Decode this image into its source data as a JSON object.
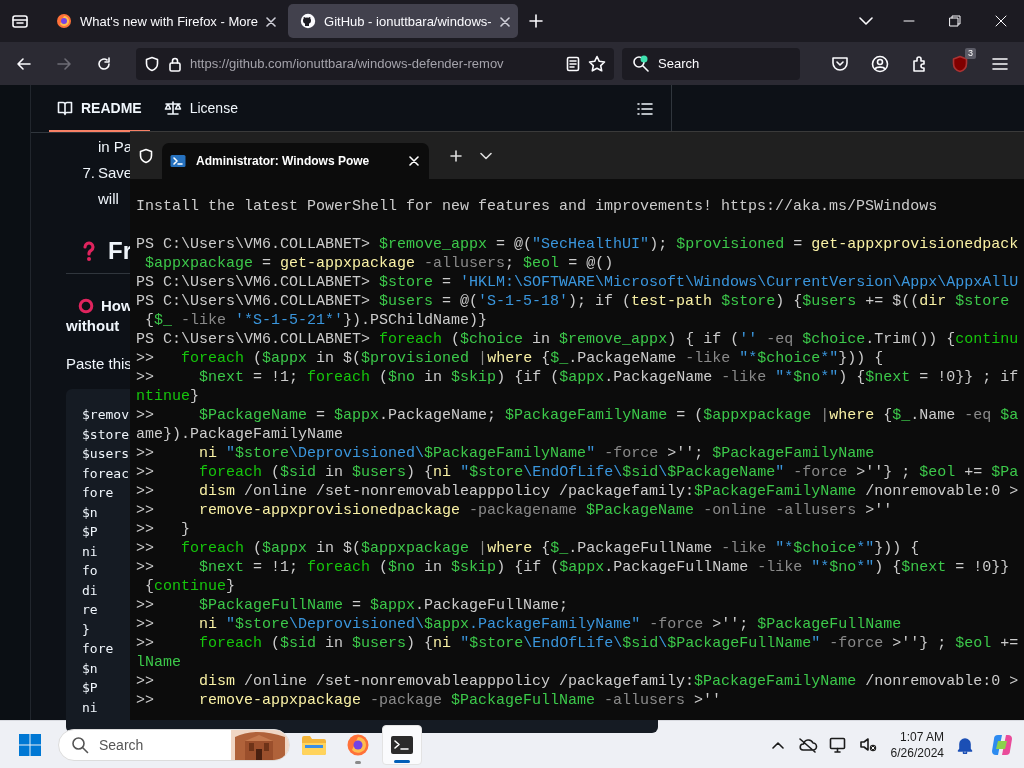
{
  "browser": {
    "tabs": [
      {
        "kind": "firefox",
        "title": "What's new with Firefox - More",
        "selected": false
      },
      {
        "kind": "github",
        "title": "GitHub - ionuttbara/windows-",
        "selected": true
      }
    ],
    "forward_disabled": true,
    "url": "https://github.com/ionuttbara/windows-defender-remov",
    "search_placeholder": "Search",
    "extension_badge": "3"
  },
  "github": {
    "nav": [
      {
        "kind": "book",
        "label": "README",
        "selected": true
      },
      {
        "kind": "scale",
        "label": "License",
        "selected": false
      }
    ],
    "content": [
      {
        "kind": "continuation",
        "text": "in Pa"
      },
      {
        "kind": "numbered",
        "number": "7.",
        "text": "Save"
      },
      {
        "kind": "continuation",
        "text": "will"
      },
      {
        "kind": "heading",
        "text": "Fr"
      },
      {
        "kind": "question",
        "text": "How"
      },
      {
        "kind": "bold",
        "text": "without"
      },
      {
        "kind": "paragraph",
        "text": "Paste this"
      }
    ],
    "code": [
      "$remov",
      "$store",
      "$users",
      "foreac",
      "  fore",
      "    $n",
      "    $P",
      "    ni",
      "    fo",
      "    di",
      "    re",
      "  }",
      "  fore",
      "    $n",
      "    $P",
      "    ni"
    ]
  },
  "terminal": {
    "tab_title": "Administrator: Windows Powe",
    "banner": "Install the latest PowerShell for new features and improvements! https://aka.ms/PSWindows",
    "lines": [
      [
        {
          "kind": "plain",
          "text": "PS C:\\Users\\VM6.COLLABNET> "
        },
        {
          "kind": "variable",
          "text": "$remove_appx"
        },
        {
          "kind": "plain",
          "text": " = @("
        },
        {
          "kind": "string",
          "text": "\"SecHealthUI\""
        },
        {
          "kind": "plain",
          "text": "); "
        },
        {
          "kind": "variable",
          "text": "$provisioned"
        },
        {
          "kind": "plain",
          "text": " = "
        },
        {
          "kind": "command",
          "text": "get-appxprovisionedpack"
        }
      ],
      [
        {
          "kind": "variable",
          "text": " $appxpackage"
        },
        {
          "kind": "plain",
          "text": " = "
        },
        {
          "kind": "command",
          "text": "get-appxpackage"
        },
        {
          "kind": "parameter",
          "text": " -allusers"
        },
        {
          "kind": "plain",
          "text": "; "
        },
        {
          "kind": "variable",
          "text": "$eol"
        },
        {
          "kind": "plain",
          "text": " = @()"
        }
      ],
      [
        {
          "kind": "plain",
          "text": "PS C:\\Users\\VM6.COLLABNET> "
        },
        {
          "kind": "variable",
          "text": "$store"
        },
        {
          "kind": "plain",
          "text": " = "
        },
        {
          "kind": "string",
          "text": "'HKLM:\\SOFTWARE\\Microsoft\\Windows\\CurrentVersion\\Appx\\AppxAllU"
        }
      ],
      [
        {
          "kind": "plain",
          "text": "PS C:\\Users\\VM6.COLLABNET> "
        },
        {
          "kind": "variable",
          "text": "$users"
        },
        {
          "kind": "plain",
          "text": " = @("
        },
        {
          "kind": "string",
          "text": "'S-1-5-18'"
        },
        {
          "kind": "plain",
          "text": "); if ("
        },
        {
          "kind": "command",
          "text": "test-path"
        },
        {
          "kind": "variable",
          "text": " $store"
        },
        {
          "kind": "plain",
          "text": ") {"
        },
        {
          "kind": "variable",
          "text": "$users"
        },
        {
          "kind": "plain",
          "text": " += $(("
        },
        {
          "kind": "command",
          "text": "dir"
        },
        {
          "kind": "variable",
          "text": " $store"
        }
      ],
      [
        {
          "kind": "plain",
          "text": " {"
        },
        {
          "kind": "variable",
          "text": "$_"
        },
        {
          "kind": "parameter",
          "text": " -like"
        },
        {
          "kind": "string",
          "text": " '*S-1-5-21*'"
        },
        {
          "kind": "plain",
          "text": "}).PSChildName)}"
        }
      ],
      [
        {
          "kind": "plain",
          "text": "PS C:\\Users\\VM6.COLLABNET> "
        },
        {
          "kind": "keyword",
          "text": "foreach"
        },
        {
          "kind": "plain",
          "text": " ("
        },
        {
          "kind": "variable",
          "text": "$choice"
        },
        {
          "kind": "plain",
          "text": " in "
        },
        {
          "kind": "variable",
          "text": "$remove_appx"
        },
        {
          "kind": "plain",
          "text": ") { if ("
        },
        {
          "kind": "string",
          "text": "''"
        },
        {
          "kind": "parameter",
          "text": " -eq"
        },
        {
          "kind": "variable",
          "text": " $choice"
        },
        {
          "kind": "plain",
          "text": ".Trim()) {"
        },
        {
          "kind": "keyword",
          "text": "continu"
        }
      ],
      [
        {
          "kind": "plain",
          "text": ">>   "
        },
        {
          "kind": "keyword",
          "text": "foreach"
        },
        {
          "kind": "plain",
          "text": " ("
        },
        {
          "kind": "variable",
          "text": "$appx"
        },
        {
          "kind": "plain",
          "text": " in $("
        },
        {
          "kind": "variable",
          "text": "$provisioned"
        },
        {
          "kind": "parameter",
          "text": " |"
        },
        {
          "kind": "command",
          "text": "where"
        },
        {
          "kind": "plain",
          "text": " {"
        },
        {
          "kind": "variable",
          "text": "$_"
        },
        {
          "kind": "plain",
          "text": ".PackageName "
        },
        {
          "kind": "parameter",
          "text": "-like"
        },
        {
          "kind": "string",
          "text": " \"*"
        },
        {
          "kind": "variable",
          "text": "$choice"
        },
        {
          "kind": "string",
          "text": "*\""
        },
        {
          "kind": "plain",
          "text": "})) {"
        }
      ],
      [
        {
          "kind": "plain",
          "text": ">>     "
        },
        {
          "kind": "variable",
          "text": "$next"
        },
        {
          "kind": "plain",
          "text": " = !1; "
        },
        {
          "kind": "keyword",
          "text": "foreach"
        },
        {
          "kind": "plain",
          "text": " ("
        },
        {
          "kind": "variable",
          "text": "$no"
        },
        {
          "kind": "plain",
          "text": " in "
        },
        {
          "kind": "variable",
          "text": "$skip"
        },
        {
          "kind": "plain",
          "text": ") {if ("
        },
        {
          "kind": "variable",
          "text": "$appx"
        },
        {
          "kind": "plain",
          "text": ".PackageName "
        },
        {
          "kind": "parameter",
          "text": "-like"
        },
        {
          "kind": "string",
          "text": " \"*"
        },
        {
          "kind": "variable",
          "text": "$no"
        },
        {
          "kind": "string",
          "text": "*\""
        },
        {
          "kind": "plain",
          "text": ") {"
        },
        {
          "kind": "variable",
          "text": "$next"
        },
        {
          "kind": "plain",
          "text": " = !0}} ; if"
        }
      ],
      [
        {
          "kind": "keyword",
          "text": "ntinue"
        },
        {
          "kind": "plain",
          "text": "}"
        }
      ],
      [
        {
          "kind": "plain",
          "text": ">>     "
        },
        {
          "kind": "variable",
          "text": "$PackageName"
        },
        {
          "kind": "plain",
          "text": " = "
        },
        {
          "kind": "variable",
          "text": "$appx"
        },
        {
          "kind": "plain",
          "text": ".PackageName; "
        },
        {
          "kind": "variable",
          "text": "$PackageFamilyName"
        },
        {
          "kind": "plain",
          "text": " = ("
        },
        {
          "kind": "variable",
          "text": "$appxpackage"
        },
        {
          "kind": "parameter",
          "text": " |"
        },
        {
          "kind": "command",
          "text": "where"
        },
        {
          "kind": "plain",
          "text": " {"
        },
        {
          "kind": "variable",
          "text": "$_"
        },
        {
          "kind": "plain",
          "text": ".Name "
        },
        {
          "kind": "parameter",
          "text": "-eq"
        },
        {
          "kind": "variable",
          "text": " $a"
        }
      ],
      [
        {
          "kind": "plain",
          "text": "ame}).PackageFamilyName"
        }
      ],
      [
        {
          "kind": "plain",
          "text": ">>     "
        },
        {
          "kind": "command",
          "text": "ni"
        },
        {
          "kind": "string",
          "text": " \""
        },
        {
          "kind": "variable",
          "text": "$store"
        },
        {
          "kind": "string",
          "text": "\\Deprovisioned\\"
        },
        {
          "kind": "variable",
          "text": "$PackageFamilyName"
        },
        {
          "kind": "string",
          "text": "\""
        },
        {
          "kind": "parameter",
          "text": " -force"
        },
        {
          "kind": "plain",
          "text": " >''; "
        },
        {
          "kind": "variable",
          "text": "$PackageFamilyName"
        }
      ],
      [
        {
          "kind": "plain",
          "text": ">>     "
        },
        {
          "kind": "keyword",
          "text": "foreach"
        },
        {
          "kind": "plain",
          "text": " ("
        },
        {
          "kind": "variable",
          "text": "$sid"
        },
        {
          "kind": "plain",
          "text": " in "
        },
        {
          "kind": "variable",
          "text": "$users"
        },
        {
          "kind": "plain",
          "text": ") {"
        },
        {
          "kind": "command",
          "text": "ni"
        },
        {
          "kind": "string",
          "text": " \""
        },
        {
          "kind": "variable",
          "text": "$store"
        },
        {
          "kind": "string",
          "text": "\\EndOfLife\\"
        },
        {
          "kind": "variable",
          "text": "$sid"
        },
        {
          "kind": "string",
          "text": "\\"
        },
        {
          "kind": "variable",
          "text": "$PackageName"
        },
        {
          "kind": "string",
          "text": "\""
        },
        {
          "kind": "parameter",
          "text": " -force"
        },
        {
          "kind": "plain",
          "text": " >''} ; "
        },
        {
          "kind": "variable",
          "text": "$eol"
        },
        {
          "kind": "plain",
          "text": " += "
        },
        {
          "kind": "variable",
          "text": "$Pa"
        }
      ],
      [
        {
          "kind": "plain",
          "text": ">>     "
        },
        {
          "kind": "command",
          "text": "dism"
        },
        {
          "kind": "plain",
          "text": " /online /set-nonremovableapppolicy /packagefamily:"
        },
        {
          "kind": "variable",
          "text": "$PackageFamilyName"
        },
        {
          "kind": "plain",
          "text": " /nonremovable:0 >"
        }
      ],
      [
        {
          "kind": "plain",
          "text": ">>     "
        },
        {
          "kind": "command",
          "text": "remove-appxprovisionedpackage"
        },
        {
          "kind": "parameter",
          "text": " -packagename"
        },
        {
          "kind": "variable",
          "text": " $PackageName"
        },
        {
          "kind": "parameter",
          "text": " -online"
        },
        {
          "kind": "parameter",
          "text": " -allusers"
        },
        {
          "kind": "plain",
          "text": " >''"
        }
      ],
      [
        {
          "kind": "plain",
          "text": ">>   }"
        }
      ],
      [
        {
          "kind": "plain",
          "text": ">>   "
        },
        {
          "kind": "keyword",
          "text": "foreach"
        },
        {
          "kind": "plain",
          "text": " ("
        },
        {
          "kind": "variable",
          "text": "$appx"
        },
        {
          "kind": "plain",
          "text": " in $("
        },
        {
          "kind": "variable",
          "text": "$appxpackage"
        },
        {
          "kind": "parameter",
          "text": " |"
        },
        {
          "kind": "command",
          "text": "where"
        },
        {
          "kind": "plain",
          "text": " {"
        },
        {
          "kind": "variable",
          "text": "$_"
        },
        {
          "kind": "plain",
          "text": ".PackageFullName "
        },
        {
          "kind": "parameter",
          "text": "-like"
        },
        {
          "kind": "string",
          "text": " \"*"
        },
        {
          "kind": "variable",
          "text": "$choice"
        },
        {
          "kind": "string",
          "text": "*\""
        },
        {
          "kind": "plain",
          "text": "})) {"
        }
      ],
      [
        {
          "kind": "plain",
          "text": ">>     "
        },
        {
          "kind": "variable",
          "text": "$next"
        },
        {
          "kind": "plain",
          "text": " = !1; "
        },
        {
          "kind": "keyword",
          "text": "foreach"
        },
        {
          "kind": "plain",
          "text": " ("
        },
        {
          "kind": "variable",
          "text": "$no"
        },
        {
          "kind": "plain",
          "text": " in "
        },
        {
          "kind": "variable",
          "text": "$skip"
        },
        {
          "kind": "plain",
          "text": ") {if ("
        },
        {
          "kind": "variable",
          "text": "$appx"
        },
        {
          "kind": "plain",
          "text": ".PackageFullName "
        },
        {
          "kind": "parameter",
          "text": "-like"
        },
        {
          "kind": "string",
          "text": " \"*"
        },
        {
          "kind": "variable",
          "text": "$no"
        },
        {
          "kind": "string",
          "text": "*\""
        },
        {
          "kind": "plain",
          "text": ") {"
        },
        {
          "kind": "variable",
          "text": "$next"
        },
        {
          "kind": "plain",
          "text": " = !0}}"
        }
      ],
      [
        {
          "kind": "plain",
          "text": " {"
        },
        {
          "kind": "keyword",
          "text": "continue"
        },
        {
          "kind": "plain",
          "text": "}"
        }
      ],
      [
        {
          "kind": "plain",
          "text": ">>     "
        },
        {
          "kind": "variable",
          "text": "$PackageFullName"
        },
        {
          "kind": "plain",
          "text": " = "
        },
        {
          "kind": "variable",
          "text": "$appx"
        },
        {
          "kind": "plain",
          "text": ".PackageFullName;"
        }
      ],
      [
        {
          "kind": "plain",
          "text": ">>     "
        },
        {
          "kind": "command",
          "text": "ni"
        },
        {
          "kind": "string",
          "text": " \""
        },
        {
          "kind": "variable",
          "text": "$store"
        },
        {
          "kind": "string",
          "text": "\\Deprovisioned\\"
        },
        {
          "kind": "variable",
          "text": "$appx"
        },
        {
          "kind": "string",
          "text": ".PackageFamilyName\""
        },
        {
          "kind": "parameter",
          "text": " -force"
        },
        {
          "kind": "plain",
          "text": " >''; "
        },
        {
          "kind": "variable",
          "text": "$PackageFullName"
        }
      ],
      [
        {
          "kind": "plain",
          "text": ">>     "
        },
        {
          "kind": "keyword",
          "text": "foreach"
        },
        {
          "kind": "plain",
          "text": " ("
        },
        {
          "kind": "variable",
          "text": "$sid"
        },
        {
          "kind": "plain",
          "text": " in "
        },
        {
          "kind": "variable",
          "text": "$users"
        },
        {
          "kind": "plain",
          "text": ") {"
        },
        {
          "kind": "command",
          "text": "ni"
        },
        {
          "kind": "string",
          "text": " \""
        },
        {
          "kind": "variable",
          "text": "$store"
        },
        {
          "kind": "string",
          "text": "\\EndOfLife\\"
        },
        {
          "kind": "variable",
          "text": "$sid"
        },
        {
          "kind": "string",
          "text": "\\"
        },
        {
          "kind": "variable",
          "text": "$PackageFullName"
        },
        {
          "kind": "string",
          "text": "\""
        },
        {
          "kind": "parameter",
          "text": " -force"
        },
        {
          "kind": "plain",
          "text": " >''} ; "
        },
        {
          "kind": "variable",
          "text": "$eol"
        },
        {
          "kind": "plain",
          "text": " +="
        }
      ],
      [
        {
          "kind": "variable",
          "text": "lName"
        }
      ],
      [
        {
          "kind": "plain",
          "text": ">>     "
        },
        {
          "kind": "command",
          "text": "dism"
        },
        {
          "kind": "plain",
          "text": " /online /set-nonremovableapppolicy /packagefamily:"
        },
        {
          "kind": "variable",
          "text": "$PackageFamilyName"
        },
        {
          "kind": "plain",
          "text": " /nonremovable:0 >"
        }
      ],
      [
        {
          "kind": "plain",
          "text": ">>     "
        },
        {
          "kind": "command",
          "text": "remove-appxpackage"
        },
        {
          "kind": "parameter",
          "text": " -package"
        },
        {
          "kind": "variable",
          "text": " $PackageFullName"
        },
        {
          "kind": "parameter",
          "text": " -allusers"
        },
        {
          "kind": "plain",
          "text": " >''"
        }
      ]
    ]
  },
  "taskbar": {
    "search_placeholder": "Search",
    "apps": [
      {
        "kind": "folder",
        "running": false,
        "active": false
      },
      {
        "kind": "firefox",
        "running": true,
        "active": false
      },
      {
        "kind": "terminal",
        "running": true,
        "active": true
      }
    ],
    "time": "1:07 AM",
    "date": "6/26/2024"
  }
}
